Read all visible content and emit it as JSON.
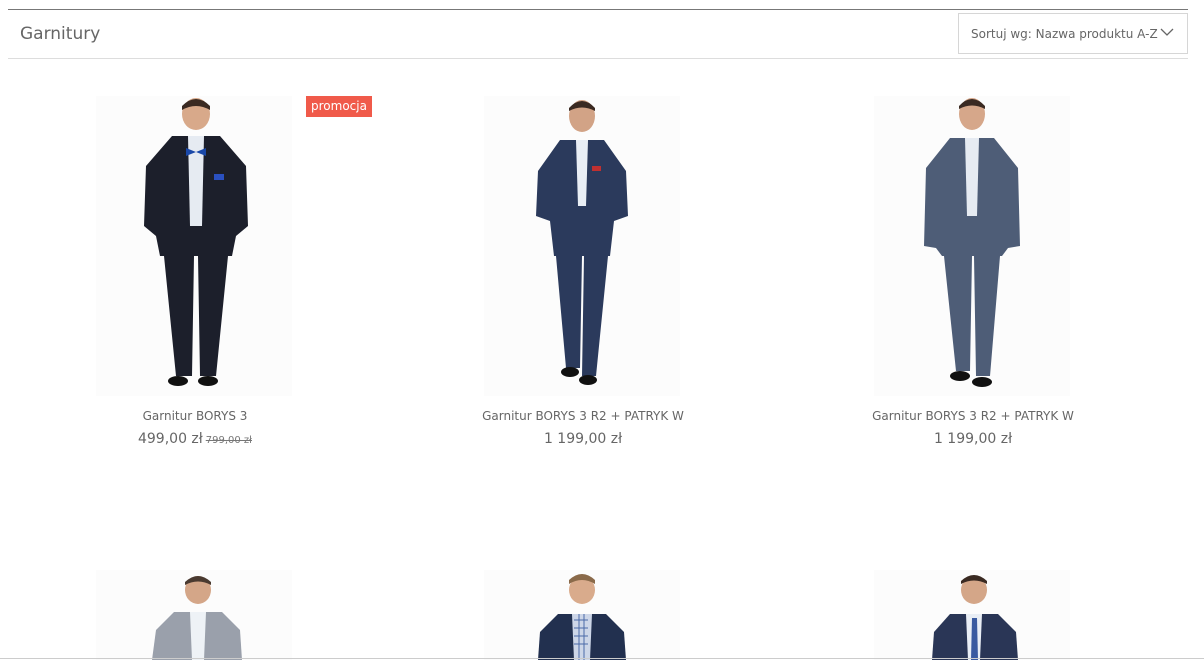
{
  "header": {
    "title": "Garnitury",
    "sort_label": "Sortuj wg: Nazwa produktu A-Z"
  },
  "colors": {
    "badge": "#f05a4a",
    "suit_black": "#1c1f2b",
    "suit_navy": "#2b3a5c",
    "suit_grey_blue": "#4e5d77",
    "suit_light_grey": "#9aa0ab"
  },
  "products": [
    {
      "name": "Garnitur BORYS 3",
      "price": "499,00 zł",
      "old_price": "799,00 zł",
      "badge": "promocja",
      "suit_color": "black"
    },
    {
      "name": "Garnitur BORYS 3 R2 + PATRYK W",
      "price": "1 199,00 zł",
      "suit_color": "navy"
    },
    {
      "name": "Garnitur BORYS 3 R2 + PATRYK W",
      "price": "1 199,00 zł",
      "suit_color": "grey-blue"
    },
    {
      "name": "",
      "price": "",
      "suit_color": "light-grey"
    },
    {
      "name": "",
      "price": "",
      "suit_color": "navy-check-shirt"
    },
    {
      "name": "",
      "price": "",
      "suit_color": "navy-tie"
    }
  ],
  "icons": {
    "sort": "chevron-down-icon"
  }
}
